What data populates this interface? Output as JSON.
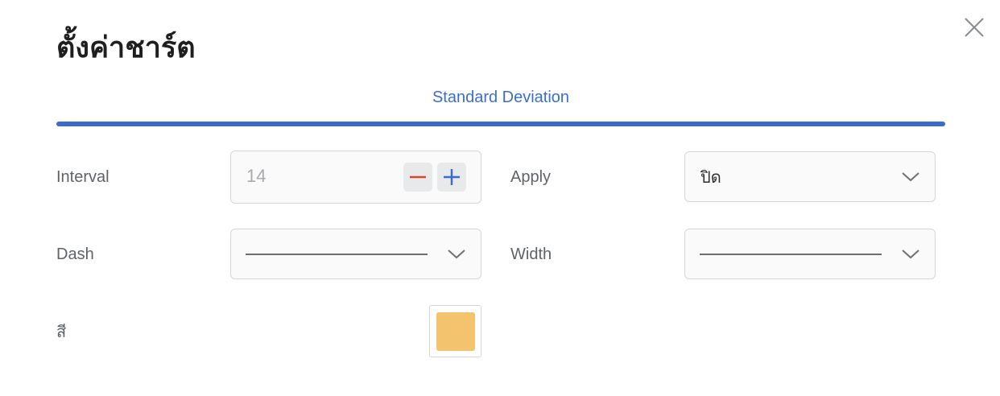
{
  "dialog": {
    "title": "ตั้งค่าชาร์ต",
    "close_icon": "close-icon"
  },
  "tabs": [
    {
      "label": "Standard Deviation",
      "active": true
    }
  ],
  "accent_color": "#3a6ccd",
  "settings": {
    "interval": {
      "label": "Interval",
      "value": "14",
      "decrement_icon": "minus-icon",
      "increment_icon": "plus-icon",
      "decrement_color": "#d9452b",
      "increment_color": "#3a6ccd"
    },
    "apply": {
      "label": "Apply",
      "selected": "ปิด",
      "icon": "chevron-down-icon"
    },
    "dash": {
      "label": "Dash",
      "selected_style": "solid",
      "icon": "chevron-down-icon"
    },
    "width": {
      "label": "Width",
      "selected_style": "thin-solid",
      "icon": "chevron-down-icon"
    },
    "color": {
      "label": "สี",
      "value": "#f4c36d"
    }
  }
}
